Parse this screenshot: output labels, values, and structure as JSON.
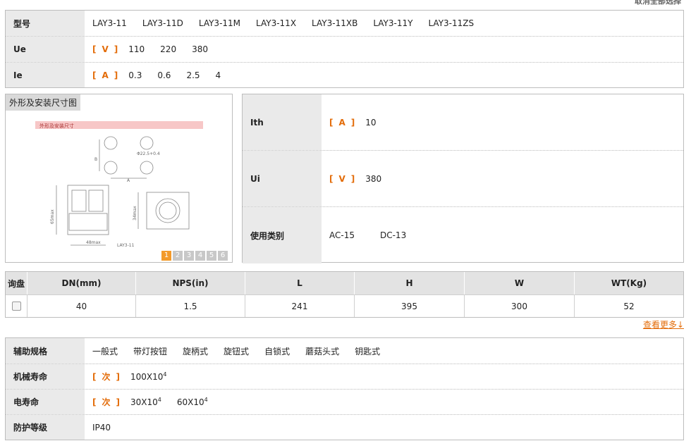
{
  "top_link": "取消全部选择",
  "spec_top": {
    "model": {
      "label": "型号",
      "options": [
        "LAY3-11",
        "LAY3-11D",
        "LAY3-11M",
        "LAY3-11X",
        "LAY3-11XB",
        "LAY3-11Y",
        "LAY3-11ZS"
      ]
    },
    "ue": {
      "label": "Ue",
      "unit": "V",
      "options": [
        "110",
        "220",
        "380"
      ]
    },
    "ie": {
      "label": "Ie",
      "unit": "A",
      "options": [
        "0.3",
        "0.6",
        "2.5",
        "4"
      ]
    }
  },
  "image_panel": {
    "title": "外形及安装尺寸图",
    "drawing_header": "外形及安装尺寸",
    "dim_a": "A",
    "dim_b": "B",
    "dim_phi": "Φ22.5+0.4",
    "dim_65": "65max",
    "dim_34": "34max",
    "dim_48": "48max",
    "caption": "LAY3-11",
    "pages": [
      "1",
      "2",
      "3",
      "4",
      "5",
      "6"
    ],
    "active_page": "1"
  },
  "spec_right": {
    "ith": {
      "label": "Ith",
      "unit": "A",
      "value": "10"
    },
    "ui": {
      "label": "Ui",
      "unit": "V",
      "value": "380"
    },
    "category": {
      "label": "使用类别",
      "options": [
        "AC-15",
        "DC-13"
      ]
    }
  },
  "dimensions": {
    "headers": [
      "询盘",
      "DN(mm)",
      "NPS(in)",
      "L",
      "H",
      "W",
      "WT(Kg)"
    ],
    "row": [
      "40",
      "1.5",
      "241",
      "395",
      "300",
      "52"
    ]
  },
  "more_link": "查看更多↓",
  "spec_bottom": {
    "aux": {
      "label": "辅助规格",
      "options": [
        "一般式",
        "带灯按钮",
        "旋柄式",
        "旋钮式",
        "自锁式",
        "蘑菇头式",
        "钥匙式"
      ]
    },
    "mech": {
      "label": "机械寿命",
      "unit": "次",
      "v1": "100X10",
      "v1_exp": "4"
    },
    "elec": {
      "label": "电寿命",
      "unit": "次",
      "v1": "30X10",
      "v1_exp": "4",
      "v2": "60X10",
      "v2_exp": "4"
    },
    "ip": {
      "label": "防护等级",
      "value": "IP40"
    }
  },
  "colors": {
    "accent": "#e36c09",
    "label_bg": "#eaeaea",
    "border": "#bdbdbd",
    "pager_active": "#f39a2b"
  }
}
